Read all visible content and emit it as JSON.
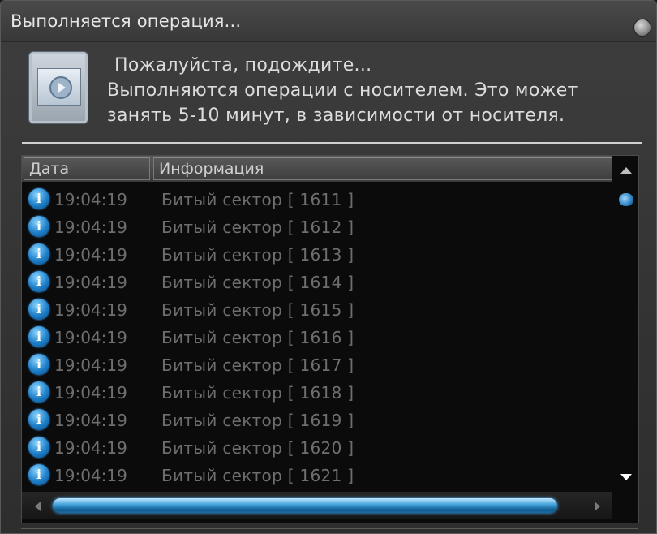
{
  "window": {
    "title": "Выполняется операция..."
  },
  "message": {
    "line1": "Пожалуйста, подождите...",
    "line2": "Выполняются операции с носителем. Это может",
    "line3": "занять 5-10 минут, в зависимости от носителя."
  },
  "log": {
    "columns": {
      "date": "Дата",
      "info": "Информация"
    },
    "rows": [
      {
        "time": "19:04:19",
        "info": "Битый сектор [ 1611 ]"
      },
      {
        "time": "19:04:19",
        "info": "Битый сектор [ 1612 ]"
      },
      {
        "time": "19:04:19",
        "info": "Битый сектор [ 1613 ]"
      },
      {
        "time": "19:04:19",
        "info": "Битый сектор [ 1614 ]"
      },
      {
        "time": "19:04:19",
        "info": "Битый сектор [ 1615 ]"
      },
      {
        "time": "19:04:19",
        "info": "Битый сектор [ 1616 ]"
      },
      {
        "time": "19:04:19",
        "info": "Битый сектор [ 1617 ]"
      },
      {
        "time": "19:04:19",
        "info": "Битый сектор [ 1618 ]"
      },
      {
        "time": "19:04:19",
        "info": "Битый сектор [ 1619 ]"
      },
      {
        "time": "19:04:19",
        "info": "Битый сектор [ 1620 ]"
      },
      {
        "time": "19:04:19",
        "info": "Битый сектор [ 1621 ]"
      }
    ],
    "row_icon": "info-icon",
    "info_glyph": "i"
  },
  "icons": {
    "app": "media-window-icon",
    "close": "close-icon"
  },
  "colors": {
    "accent": "#2b8fd6",
    "text": "#dcdcdc",
    "muted": "#6e6e6e"
  }
}
